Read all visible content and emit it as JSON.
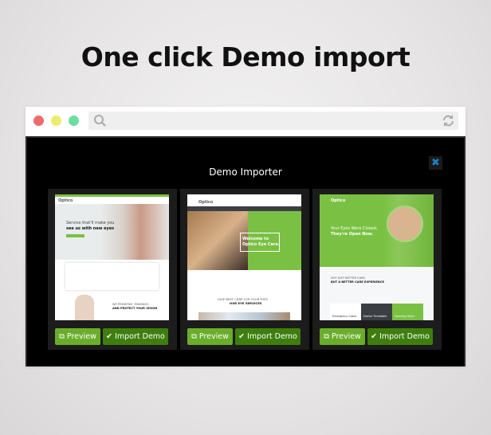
{
  "headline": "One click Demo import",
  "browser": {
    "traffic_lights": [
      "#ef6a6a",
      "#eded6d",
      "#6bdfa2"
    ],
    "url_value": ""
  },
  "modal": {
    "title": "Demo Importer",
    "close_icon": "close-icon"
  },
  "colors": {
    "brand_green": "#7ac143",
    "preview_button": "#6aad2b",
    "import_button": "#3e7e0e"
  },
  "demos": [
    {
      "logo": "Optico",
      "hero1": "Service that'll make you",
      "hero2": "see us with new eyes",
      "section1": "WE PRESERVE, ENHANCE,",
      "section2": "AND PROTECT YOUR VISION",
      "preview": "Preview",
      "import": "Import Demo"
    },
    {
      "logo": "Optico",
      "hero1": "Welcome to",
      "hero2": "Optico Eye Care.",
      "section1": "GIVE BEST CARE FOR YOUR EYES",
      "section2": "OUR EYE SERVICES",
      "preview": "Preview",
      "import": "Import Demo"
    },
    {
      "logo": "Optico",
      "hero1": "Your Eyes Were Closed,",
      "hero2": "They're Open Now.",
      "section1": "NOT JUST BETTER CARE,",
      "section2": "BUT A BETTER CARE EXPERIENCE",
      "boxes": [
        "Emergency Cases",
        "Doctor Timetable",
        "Opening Hours"
      ],
      "preview": "Preview",
      "import": "Import Demo"
    }
  ]
}
